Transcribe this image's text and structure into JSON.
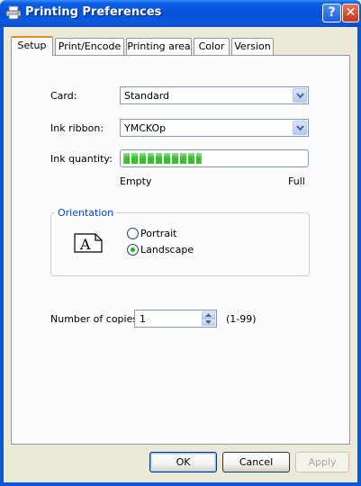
{
  "window": {
    "title": "Printing Preferences",
    "help_glyph": "?",
    "close_glyph": "✕"
  },
  "tabs": [
    {
      "label": "Setup",
      "active": true
    },
    {
      "label": "Print/Encode",
      "active": false
    },
    {
      "label": "Printing area",
      "active": false
    },
    {
      "label": "Color",
      "active": false
    },
    {
      "label": "Version",
      "active": false
    }
  ],
  "setup": {
    "card": {
      "label": "Card:",
      "value": "Standard"
    },
    "ribbon": {
      "label": "Ink ribbon:",
      "value": "YMCKOp"
    },
    "ink": {
      "label": "Ink quantity:",
      "level_percent": 43,
      "min_label": "Empty",
      "max_label": "Full"
    },
    "orientation": {
      "legend": "Orientation",
      "icon_glyph": "A",
      "options": [
        {
          "label": "Portrait",
          "checked": false
        },
        {
          "label": "Landscape",
          "checked": true
        }
      ]
    },
    "copies": {
      "label": "Number of copies:",
      "value": "1",
      "range": "(1-99)"
    }
  },
  "buttons": {
    "ok": "OK",
    "cancel": "Cancel",
    "apply": "Apply"
  },
  "icons": {
    "title": "printer-icon",
    "combo_arrow": "chevron-down-icon",
    "orientation": "landscape-page-icon"
  }
}
